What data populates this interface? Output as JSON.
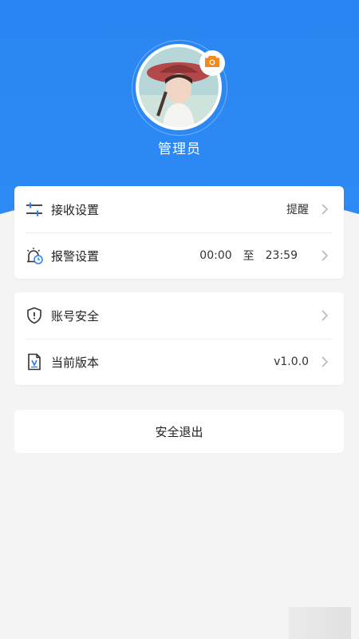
{
  "profile": {
    "username": "管理员"
  },
  "settings_card": {
    "receive": {
      "label": "接收设置",
      "value": "提醒"
    },
    "alarm": {
      "label": "报警设置",
      "start": "00:00",
      "separator": "至",
      "end": "23:59"
    }
  },
  "account_card": {
    "security": {
      "label": "账号安全"
    },
    "version": {
      "label": "当前版本",
      "value": "v1.0.0"
    }
  },
  "logout": {
    "label": "安全退出"
  },
  "colors": {
    "brand_blue": "#2a86f2",
    "camera_orange": "#f28a1c",
    "background": "#f4f4f4"
  },
  "icons": {
    "receive": "sliders-icon",
    "alarm": "alarm-clock-icon",
    "security": "shield-icon",
    "version": "version-file-icon",
    "camera": "camera-icon",
    "chevron": "chevron-right-icon"
  }
}
